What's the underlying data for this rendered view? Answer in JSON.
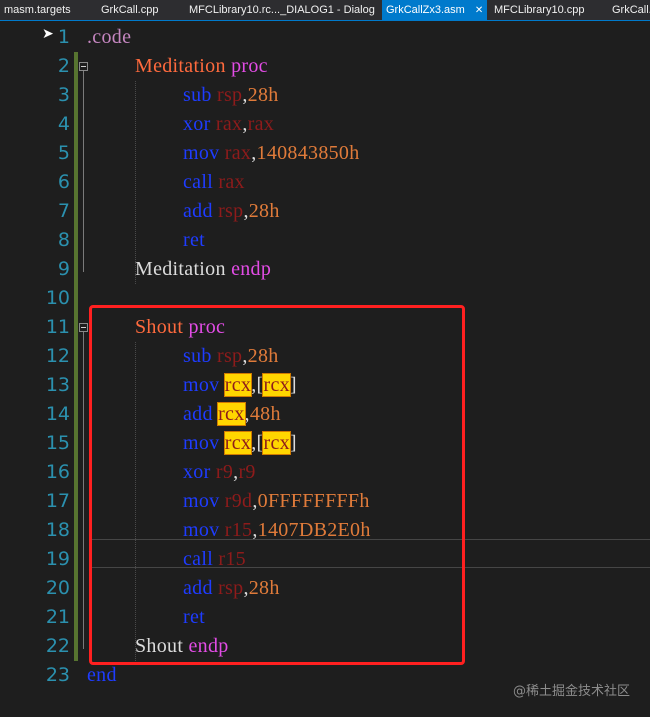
{
  "tabs": [
    {
      "label": "masm.targets",
      "active": false
    },
    {
      "label": "GrkCall.cpp",
      "active": false
    },
    {
      "label": "MFCLibrary10.rc..._DIALOG1 - Dialog",
      "active": false
    },
    {
      "label": "GrkCallZx3.asm",
      "active": true,
      "close": "✕"
    },
    {
      "label": "MFCLibrary10.cpp",
      "active": false
    },
    {
      "label": "GrkCall.h",
      "active": false
    }
  ],
  "lines": [
    {
      "n": "1",
      "tokens": [
        {
          "t": ".code",
          "c": "kw-dir"
        }
      ]
    },
    {
      "n": "2",
      "tokens": [
        {
          "t": "Meditation",
          "c": "kw-name"
        },
        {
          "t": " ",
          "c": "punc"
        },
        {
          "t": "proc",
          "c": "kw-proc"
        }
      ]
    },
    {
      "n": "3",
      "tokens": [
        {
          "t": "sub",
          "c": "op"
        },
        {
          "t": " ",
          "c": "punc"
        },
        {
          "t": "rsp",
          "c": "reg"
        },
        {
          "t": ",",
          "c": "punc"
        },
        {
          "t": "28h",
          "c": "num"
        }
      ]
    },
    {
      "n": "4",
      "tokens": [
        {
          "t": "xor",
          "c": "op"
        },
        {
          "t": " ",
          "c": "punc"
        },
        {
          "t": "rax",
          "c": "reg"
        },
        {
          "t": ",",
          "c": "punc"
        },
        {
          "t": "rax",
          "c": "reg"
        }
      ]
    },
    {
      "n": "5",
      "tokens": [
        {
          "t": "mov",
          "c": "op"
        },
        {
          "t": " ",
          "c": "punc"
        },
        {
          "t": "rax",
          "c": "reg"
        },
        {
          "t": ",",
          "c": "punc"
        },
        {
          "t": "140843850h",
          "c": "num"
        }
      ]
    },
    {
      "n": "6",
      "tokens": [
        {
          "t": "call",
          "c": "op"
        },
        {
          "t": " ",
          "c": "punc"
        },
        {
          "t": "rax",
          "c": "reg"
        }
      ]
    },
    {
      "n": "7",
      "tokens": [
        {
          "t": "add",
          "c": "op"
        },
        {
          "t": " ",
          "c": "punc"
        },
        {
          "t": "rsp",
          "c": "reg"
        },
        {
          "t": ",",
          "c": "punc"
        },
        {
          "t": "28h",
          "c": "num"
        }
      ]
    },
    {
      "n": "8",
      "tokens": [
        {
          "t": "ret",
          "c": "op"
        }
      ]
    },
    {
      "n": "9",
      "tokens": [
        {
          "t": "Meditation",
          "c": "kw-plain"
        },
        {
          "t": " ",
          "c": "punc"
        },
        {
          "t": "endp",
          "c": "kw-proc"
        }
      ]
    },
    {
      "n": "10",
      "tokens": []
    },
    {
      "n": "11",
      "tokens": [
        {
          "t": "Shout",
          "c": "kw-name"
        },
        {
          "t": " ",
          "c": "punc"
        },
        {
          "t": "proc",
          "c": "kw-proc"
        }
      ]
    },
    {
      "n": "12",
      "tokens": [
        {
          "t": "sub",
          "c": "op"
        },
        {
          "t": " ",
          "c": "punc"
        },
        {
          "t": "rsp",
          "c": "reg"
        },
        {
          "t": ",",
          "c": "punc"
        },
        {
          "t": "28h",
          "c": "num"
        }
      ]
    },
    {
      "n": "13",
      "tokens": [
        {
          "t": "mov",
          "c": "op"
        },
        {
          "t": " ",
          "c": "punc"
        },
        {
          "t": "rcx",
          "c": "reg hl"
        },
        {
          "t": ",[",
          "c": "punc"
        },
        {
          "t": "rcx",
          "c": "reg hl"
        },
        {
          "t": "]",
          "c": "punc"
        }
      ]
    },
    {
      "n": "14",
      "tokens": [
        {
          "t": "add",
          "c": "op"
        },
        {
          "t": " ",
          "c": "punc"
        },
        {
          "t": "rcx",
          "c": "reg hl"
        },
        {
          "t": ",",
          "c": "punc"
        },
        {
          "t": "48h",
          "c": "num"
        }
      ]
    },
    {
      "n": "15",
      "tokens": [
        {
          "t": "mov",
          "c": "op"
        },
        {
          "t": " ",
          "c": "punc"
        },
        {
          "t": "rcx",
          "c": "reg hl"
        },
        {
          "t": ",[",
          "c": "punc"
        },
        {
          "t": "rcx",
          "c": "reg hl"
        },
        {
          "t": "]",
          "c": "punc"
        }
      ]
    },
    {
      "n": "16",
      "tokens": [
        {
          "t": "xor",
          "c": "op"
        },
        {
          "t": " ",
          "c": "punc"
        },
        {
          "t": "r9",
          "c": "reg"
        },
        {
          "t": ",",
          "c": "punc"
        },
        {
          "t": "r9",
          "c": "reg"
        }
      ]
    },
    {
      "n": "17",
      "tokens": [
        {
          "t": "mov",
          "c": "op"
        },
        {
          "t": " ",
          "c": "punc"
        },
        {
          "t": "r9d",
          "c": "reg"
        },
        {
          "t": ",",
          "c": "punc"
        },
        {
          "t": "0FFFFFFFFh",
          "c": "num"
        }
      ]
    },
    {
      "n": "18",
      "tokens": [
        {
          "t": "mov",
          "c": "op"
        },
        {
          "t": " ",
          "c": "punc"
        },
        {
          "t": "r15",
          "c": "reg"
        },
        {
          "t": ",",
          "c": "punc"
        },
        {
          "t": "1407DB2E0h",
          "c": "num"
        }
      ]
    },
    {
      "n": "19",
      "tokens": [
        {
          "t": "call",
          "c": "op"
        },
        {
          "t": " ",
          "c": "punc"
        },
        {
          "t": "r15",
          "c": "reg"
        }
      ]
    },
    {
      "n": "20",
      "tokens": [
        {
          "t": "add",
          "c": "op"
        },
        {
          "t": " ",
          "c": "punc"
        },
        {
          "t": "rsp",
          "c": "reg"
        },
        {
          "t": ",",
          "c": "punc"
        },
        {
          "t": "28h",
          "c": "num"
        }
      ]
    },
    {
      "n": "21",
      "tokens": [
        {
          "t": "ret",
          "c": "op"
        }
      ]
    },
    {
      "n": "22",
      "tokens": [
        {
          "t": "Shout",
          "c": "kw-plain"
        },
        {
          "t": " ",
          "c": "punc"
        },
        {
          "t": "endp",
          "c": "kw-proc"
        }
      ]
    },
    {
      "n": "23",
      "tokens": [
        {
          "t": "end",
          "c": "op"
        }
      ]
    }
  ],
  "watermark": "@稀土掘金技术社区",
  "colors": {
    "tab_active": "#007acc",
    "annotation_box": "#ff2020",
    "highlight": "#ffd600"
  }
}
